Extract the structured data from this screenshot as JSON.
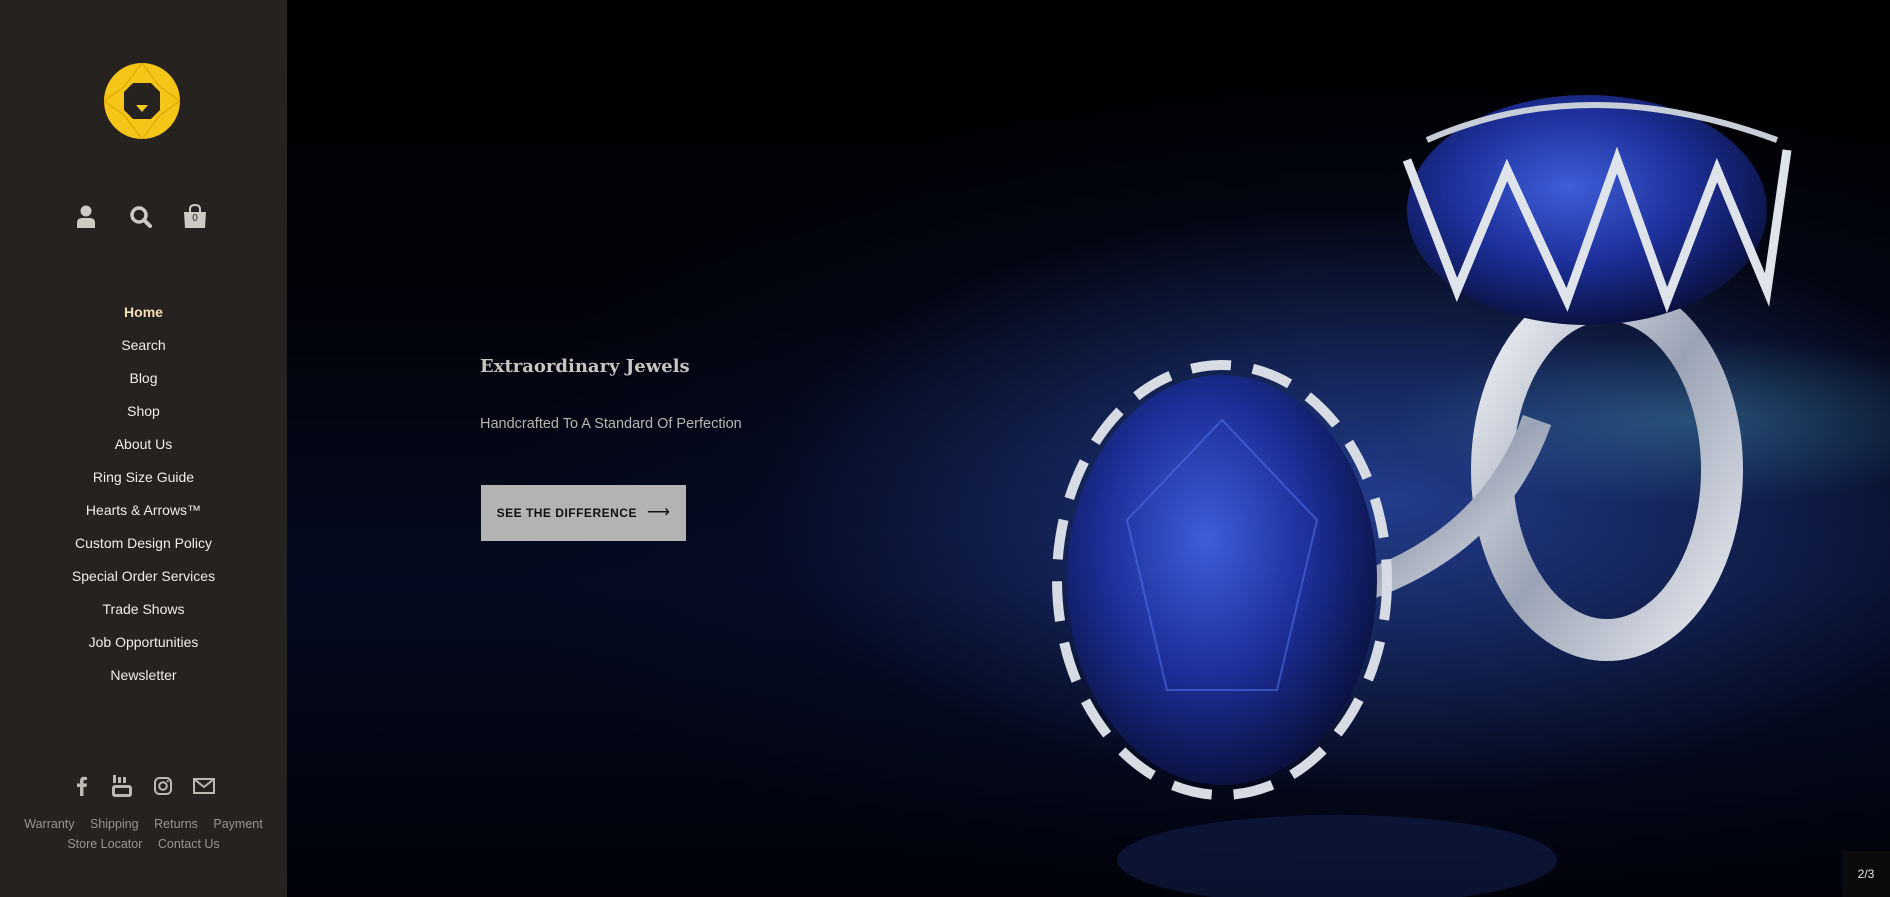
{
  "brand": {
    "logo_icon": "yellow-diamond-logo-icon",
    "accent": "#f5c518",
    "sidebar_bg": "#252220"
  },
  "header_icons": {
    "account": "user-icon",
    "search": "search-icon",
    "cart": "shopping-bag-icon",
    "cart_count": "0"
  },
  "nav": {
    "items": [
      "Home",
      "Search",
      "Blog",
      "Shop",
      "About Us",
      "Ring Size Guide",
      "Hearts & Arrows™",
      "Custom Design Policy",
      "Special Order Services",
      "Trade Shows",
      "Job Opportunities",
      "Newsletter"
    ],
    "active": "Home"
  },
  "social": {
    "facebook": "facebook-icon",
    "youtube": "youtube-icon",
    "instagram": "instagram-icon",
    "email": "mail-icon"
  },
  "footer_links": [
    "Warranty",
    "Shipping",
    "Returns",
    "Payment",
    "Store Locator",
    "Contact Us"
  ],
  "hero": {
    "title": "Extraordinary Jewels",
    "subtitle": "Handcrafted To A Standard Of Perfection",
    "cta_label": "SEE THE DIFFERENCE",
    "cta_arrow": "⟶",
    "slide_counter": "2/3",
    "image": "blue sapphire rings photo"
  }
}
